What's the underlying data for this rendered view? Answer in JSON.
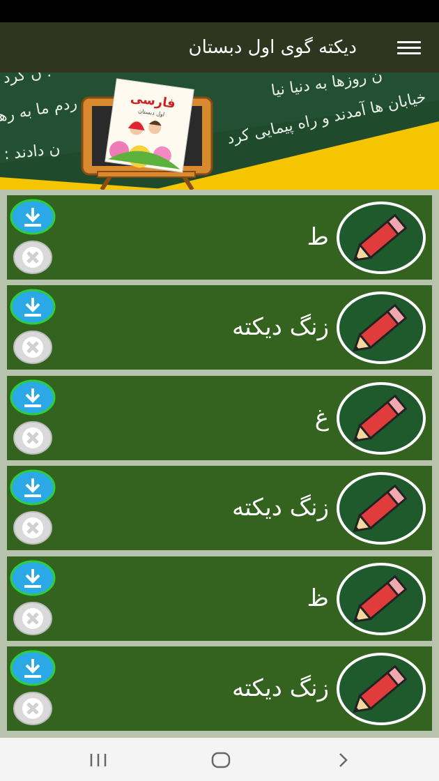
{
  "app_bar": {
    "title": "دیکته گوی اول دبستان",
    "menu_icon": "hamburger-menu-icon"
  },
  "banner": {
    "chalk_lines": [
      "ن روزها به دنیا نیا",
      "ن کرد .",
      "خیابان ها آمدند و راه پیمایی کرد",
      "ردم ما به رهب",
      "ن دادند : « ا"
    ],
    "book_title": "فارسی",
    "book_subtitle": "اول دبستان"
  },
  "items": [
    {
      "label": "ط"
    },
    {
      "label": "زنگ دیکته"
    },
    {
      "label": "غ"
    },
    {
      "label": "زنگ دیکته"
    },
    {
      "label": "ظ"
    },
    {
      "label": "زنگ دیکته"
    }
  ],
  "colors": {
    "status_bar": "#000000",
    "app_bar": "#30351f",
    "row_bg": "#34621f",
    "list_bg": "#b8c3ad",
    "download_blue": "#2aa9e6",
    "download_ring": "#2ccf3a",
    "pencil_red": "#e03c3c"
  },
  "nav": {
    "recents_icon": "recents-icon",
    "home_icon": "home-icon",
    "back_icon": "back-icon"
  }
}
